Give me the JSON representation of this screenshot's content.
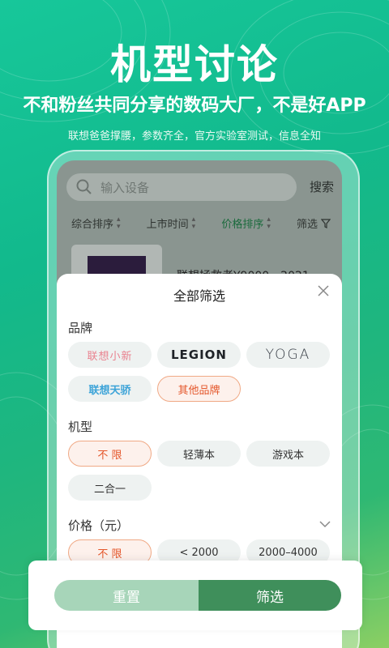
{
  "hero": {
    "title": "机型讨论",
    "subtitle": "不和粉丝共同分享的数码大厂，不是好APP",
    "tagline": "联想爸爸撑腰，参数齐全，官方实验室测试，信息全知"
  },
  "search": {
    "placeholder": "输入设备",
    "button": "搜索"
  },
  "sort": {
    "items": [
      "综合排序",
      "上市时间",
      "价格排序",
      "筛选"
    ],
    "active_index": 2
  },
  "product": {
    "name": "联想拯救者Y9000…2021"
  },
  "filter": {
    "title": "全部筛选",
    "brand": {
      "label": "品牌",
      "options": [
        "联想小新",
        "LEGION",
        "YOGA",
        "联想天骄",
        "其他品牌"
      ],
      "selected": "其他品牌"
    },
    "model": {
      "label": "机型",
      "options": [
        "不 限",
        "轻薄本",
        "游戏本",
        "二合一"
      ],
      "selected": "不 限"
    },
    "price": {
      "label": "价格（元）",
      "options": [
        "不 限",
        "< 2000",
        "2000–4000"
      ],
      "selected": "不 限"
    },
    "reset": "重置",
    "apply": "筛选"
  },
  "colors": {
    "accent_green": "#3f8f5b",
    "reset_green": "#a7d5b9",
    "selected_orange": "#e4562a",
    "background_green": "#17c79a"
  }
}
